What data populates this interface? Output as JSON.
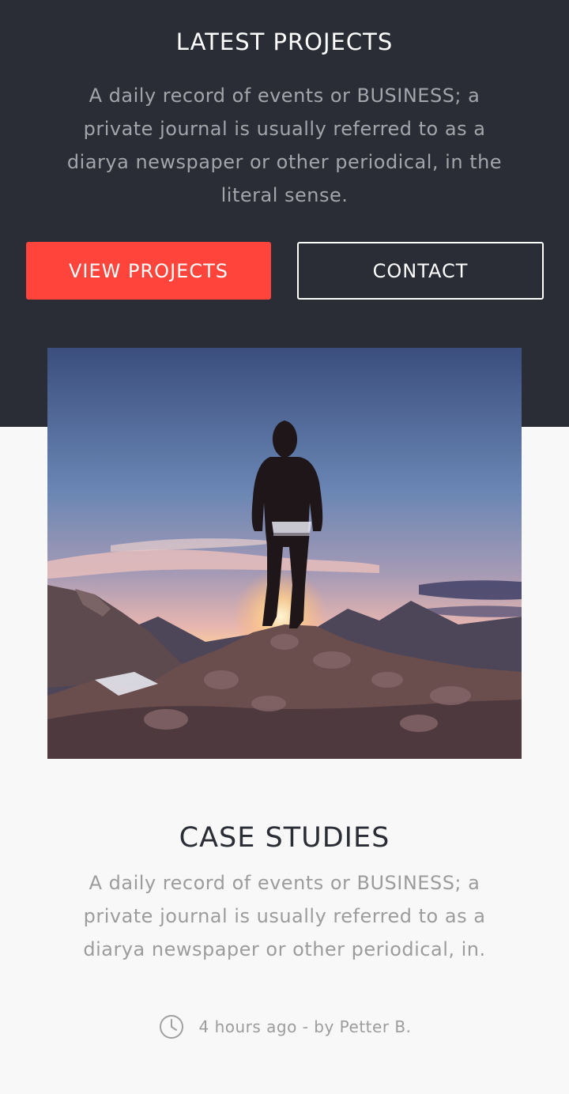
{
  "hero": {
    "title": "LATEST PROJECTS",
    "description": "A daily record of events or BUSINESS; a private journal is usually referred to as a diarya newspaper or other periodical, in the literal sense.",
    "primary_button": "VIEW PROJECTS",
    "secondary_button": "CONTACT",
    "background_color": "#2a2d35",
    "accent_color": "#ff443b"
  },
  "case_study": {
    "title": "CASE STUDIES",
    "description": "A daily record of events or BUSINESS; a private journal is usually referred to as a diarya newspaper or other periodical, in.",
    "meta_icon": "clock-icon",
    "meta": "4 hours ago - by Petter B."
  }
}
